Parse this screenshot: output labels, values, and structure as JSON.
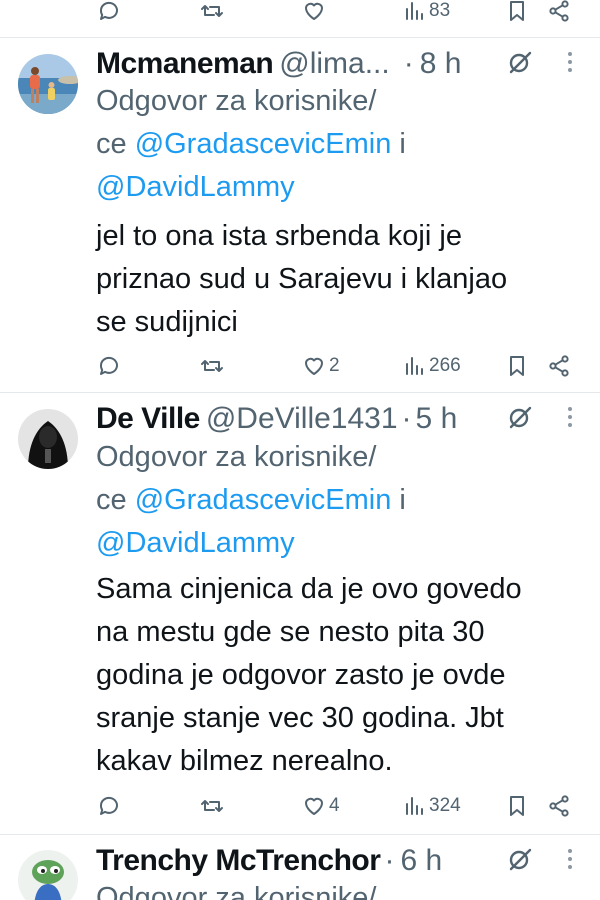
{
  "top_actions": {
    "views": "83"
  },
  "tweets": [
    {
      "name": "Mcmaneman",
      "handle": "@lima...",
      "time": "8 h",
      "reply_prefix": "Odgovor za korisnike/",
      "reply_mid": "ce ",
      "mention1": "@GradascevicEmin",
      "reply_and": " i",
      "mention2": "@DavidLammy",
      "lines": [
        "jel to ona ista srbenda koji je",
        "priznao sud u Sarajevu i klanjao",
        "se sudijnici"
      ],
      "likes": "2",
      "views": "266"
    },
    {
      "name": "De Ville",
      "handle": "@DeVille1431",
      "time": "5 h",
      "reply_prefix": "Odgovor za korisnike/",
      "reply_mid": "ce ",
      "mention1": "@GradascevicEmin",
      "reply_and": " i",
      "mention2": "@DavidLammy",
      "lines": [
        "Sama cinjenica da je ovo govedo",
        "na mestu gde se nesto pita 30",
        "godina je odgovor zasto je ovde",
        "sranje stanje vec 30 godina. Jbt",
        "kakav bilmez nerealno."
      ],
      "likes": "4",
      "views": "324"
    },
    {
      "name": "Trenchy McTrenchor",
      "time": "6 h",
      "reply_prefix": "Odgovor za korisnike/"
    }
  ],
  "icons": {
    "reply": "speech-bubble-icon",
    "repost": "repost-arrows-icon",
    "like": "heart-icon",
    "views": "bar-chart-icon",
    "bookmark": "bookmark-icon",
    "share": "share-nodes-icon",
    "grok": "grok-icon",
    "more": "more-dots-icon"
  },
  "colors": {
    "mention": "#1d9bf0",
    "secondary_text": "#536471",
    "text": "#0f1419",
    "divider": "#e6e9eb"
  }
}
